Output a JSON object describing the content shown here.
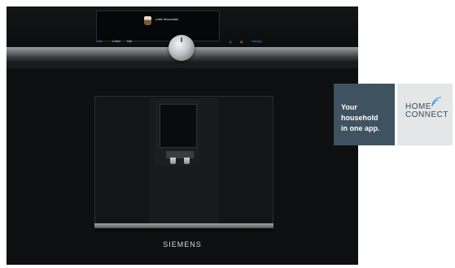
{
  "machine": {
    "screen_text": "Latte Macchiato",
    "controls_left": [
      "Latte",
      "Coffee",
      "Milk"
    ],
    "controls_right": [
      "◁",
      "◎",
      "Settings"
    ],
    "brand": "SIEMENS"
  },
  "promo": {
    "line1": "Your",
    "line2": "household",
    "line3": "in one app."
  },
  "home_connect": {
    "word1": "HOME",
    "word2": "CONNECT"
  },
  "colors": {
    "promo_bg": "#3f525f",
    "accent_blue": "#3d8fe0",
    "hc_bg": "#e4e6e8"
  }
}
